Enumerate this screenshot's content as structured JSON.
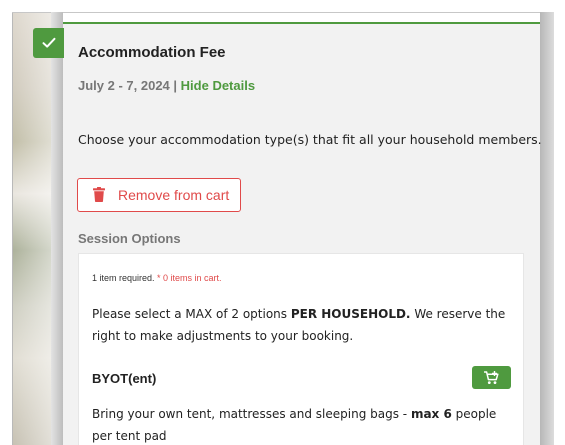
{
  "fee": {
    "title": "Accommodation Fee",
    "dates": "July 2 - 7, 2024",
    "separator": " | ",
    "hide_details_label": "Hide Details",
    "description": "Choose your accommodation type(s) that fit all your household members.",
    "remove_button_label": "Remove from cart"
  },
  "session_options": {
    "title": "Session Options",
    "required_text": "1 item required. ",
    "cart_status": "* 0 items in cart.",
    "note_prefix": "Please select a MAX of 2 options ",
    "note_bold": "PER HOUSEHOLD.",
    "note_suffix": " We reserve the right to make adjustments to your booking.",
    "option": {
      "name": "BYOT(ent)",
      "desc_prefix": "Bring your own tent, mattresses and sleeping bags - ",
      "desc_bold": "max 6",
      "desc_suffix": " people per tent pad"
    }
  },
  "icons": {
    "check": "check-icon",
    "trash": "trash-icon",
    "cart": "cart-plus-icon"
  },
  "colors": {
    "accent_green": "#4f9a3f",
    "danger_red": "#e04a4a",
    "muted_text": "#777777"
  }
}
